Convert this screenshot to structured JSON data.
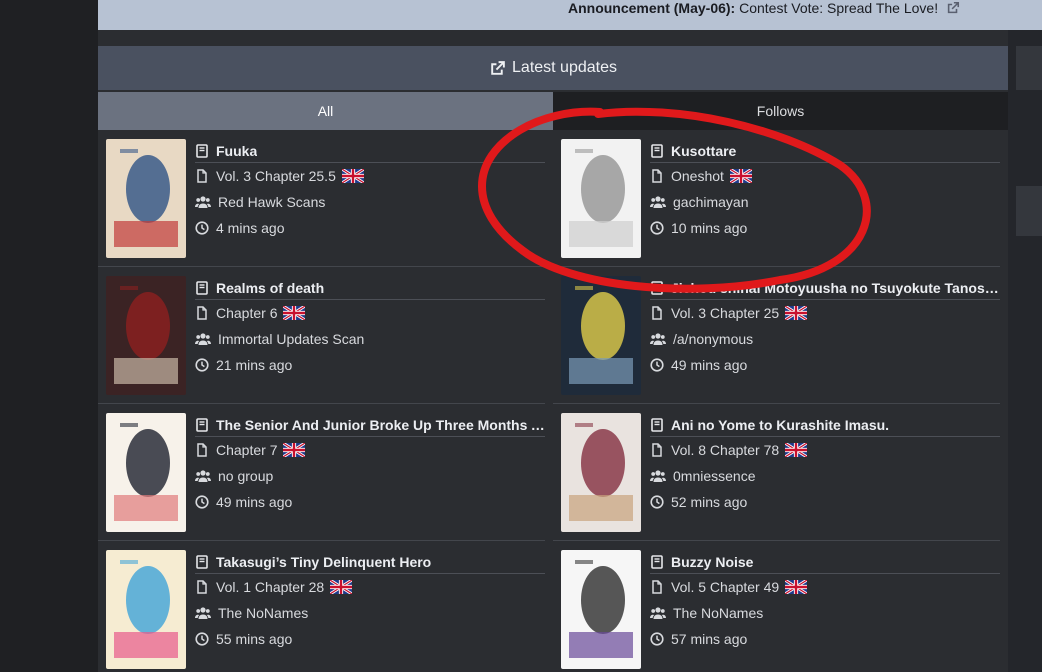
{
  "announcement": {
    "label": "Announcement (May-06):",
    "text": "Contest Vote: Spread The Love!"
  },
  "header": {
    "title": "Latest updates"
  },
  "tabs": [
    {
      "label": "All"
    },
    {
      "label": "Follows"
    }
  ],
  "icons": {
    "external_link": "external-link-icon",
    "book": "book-icon",
    "file": "file-icon",
    "group": "users-icon",
    "clock": "clock-icon",
    "flag": "uk-flag-icon"
  },
  "colors": {
    "annotation": "#e0191b",
    "header": "#4a5160",
    "active_tab": "#6b7280"
  },
  "updates": [
    {
      "title": "Fuuka",
      "chapter": "Vol. 3 Chapter 25.5",
      "group": "Red Hawk Scans",
      "time": "4 mins ago"
    },
    {
      "title": "Kusottare",
      "chapter": "Oneshot",
      "group": "gachimayan",
      "time": "10 mins ago"
    },
    {
      "title": "Realms of death",
      "chapter": "Chapter 6",
      "group": "Immortal Updates Scan",
      "time": "21 mins ago"
    },
    {
      "title": "Jichou shinai Motoyuusha no Tsuyokute Tanoshii New Game",
      "chapter": "Vol. 3 Chapter 25",
      "group": "/a/nonymous",
      "time": "49 mins ago"
    },
    {
      "title": "The Senior And Junior Broke Up Three Months Ago",
      "chapter": "Chapter 7",
      "group": "no group",
      "time": "49 mins ago"
    },
    {
      "title": "Ani no Yome to Kurashite Imasu.",
      "chapter": "Vol. 8 Chapter 78",
      "group": "0mniessence",
      "time": "52 mins ago"
    },
    {
      "title": "Takasugi’s Tiny Delinquent Hero",
      "chapter": "Vol. 1 Chapter 28",
      "group": "The NoNames",
      "time": "55 mins ago"
    },
    {
      "title": "Buzzy Noise",
      "chapter": "Vol. 5 Chapter 49",
      "group": "The NoNames",
      "time": "57 mins ago"
    }
  ]
}
